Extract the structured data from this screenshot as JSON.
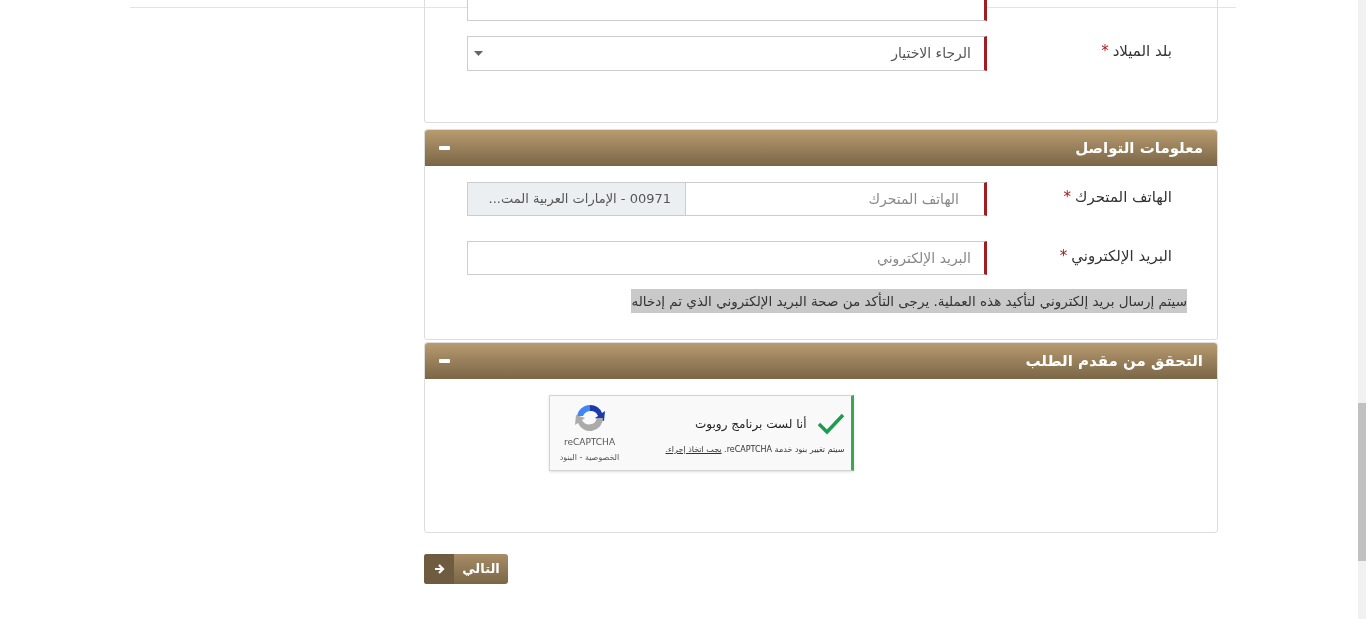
{
  "birth_place": {
    "label": "بلد الميلاد",
    "required_mark": "*",
    "placeholder": "الرجاء الاختيار"
  },
  "contact": {
    "title": "معلومات التواصل",
    "expanded": true,
    "phone": {
      "label": "الهاتف المتحرك",
      "required_mark": "*",
      "placeholder": "الهاتف المتحرك",
      "country_code": "00971 - الإمارات العربية المت..."
    },
    "email": {
      "label": "البريد الإلكتروني",
      "required_mark": "*",
      "placeholder": "البريد الإلكتروني"
    },
    "note": "سيتم إرسال بريد إلكتروني لتأكيد هذه العملية. يرجى التأكد من صحة البريد الإلكتروني الذي تم إدخاله"
  },
  "verification": {
    "title": "التحقق من مقدم الطلب",
    "expanded": true,
    "captcha": {
      "checked": true,
      "label": "أنا لست برنامج روبوت",
      "brand": "reCAPTCHA",
      "links": "الخصوصية - البنود",
      "terms": "سيتم تغيير بنود خدمة reCAPTCHA.",
      "terms_link": "يجب اتخاذ إجراء."
    }
  },
  "next_button": "التالي"
}
